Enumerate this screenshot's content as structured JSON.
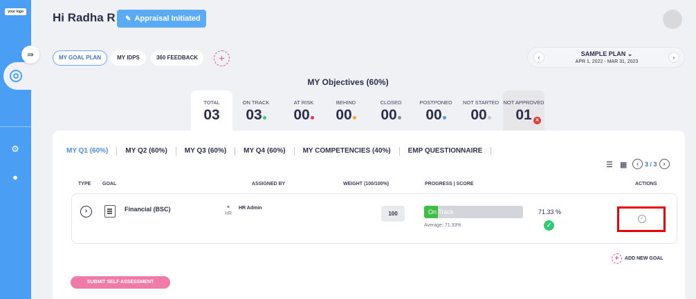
{
  "logo_text": "your logo",
  "header": {
    "greeting": "Hi Radha R",
    "status_button": "Appraisal Initiated"
  },
  "nav_pills": [
    {
      "label": "MY GOAL PLAN",
      "active": true
    },
    {
      "label": "MY IDPS",
      "active": false
    },
    {
      "label": "360 FEEDBACK",
      "active": false
    }
  ],
  "plan": {
    "name": "SAMPLE PLAN",
    "dates": "APR 1, 2022 - MAR 31, 2023"
  },
  "objectives_title": "MY Objectives (60%)",
  "stats": [
    {
      "label": "TOTAL",
      "value": "03",
      "dot": ""
    },
    {
      "label": "ON TRACK",
      "value": "03",
      "dot": "#2ecc71"
    },
    {
      "label": "AT RISK",
      "value": "00",
      "dot": "#e23b3b"
    },
    {
      "label": "BEHIND",
      "value": "00",
      "dot": "#f5a623"
    },
    {
      "label": "CLOSED",
      "value": "00",
      "dot": "#8e8e96"
    },
    {
      "label": "POSTPONED",
      "value": "00",
      "dot": "#4a9ff5"
    },
    {
      "label": "NOT STARTED",
      "value": "00",
      "dot": "#c7c7cc"
    },
    {
      "label": "NOT APPROVED",
      "value": "01",
      "dot": ""
    }
  ],
  "quarter_tabs": [
    "MY Q1 (60%)",
    "MY Q2 (60%)",
    "MY Q3 (60%)",
    "MY Q4 (60%)",
    "MY COMPETENCIES (40%)",
    "EMP QUESTIONNAIRE"
  ],
  "pager": "3 / 3",
  "table": {
    "headers": {
      "type": "TYPE",
      "goal": "GOAL",
      "assigned_by": "ASSIGNED BY",
      "weight": "WEIGHT (100/100%)",
      "progress": "PROGRESS | SCORE",
      "actions": "ACTIONS"
    },
    "row": {
      "goal": "Financial (BSC)",
      "assigned_by": "HR Admin",
      "assignee_img_alt": "HR",
      "weight": "100",
      "progress_label": "On Track",
      "progress_fraction": 0.14,
      "average": "Average: 71.33%",
      "score": "71.33  %"
    }
  },
  "add_goal_label": "ADD NEW GOAL",
  "submit_label": "SUBMIT SELF ASSESSMENT",
  "colors": {
    "accent": "#4a9ff5",
    "progress": "#3dbe45",
    "highlight_box": "#e00000"
  }
}
